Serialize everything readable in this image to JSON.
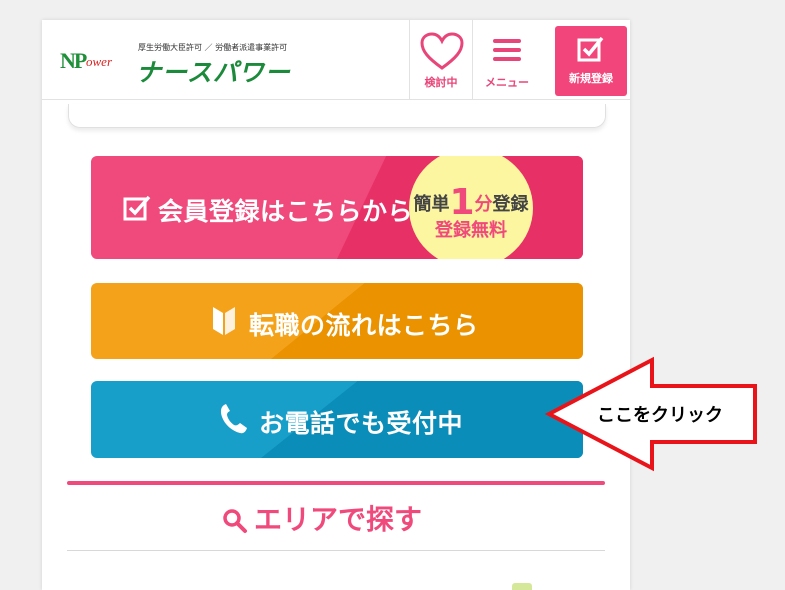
{
  "header": {
    "logo_mark": "NP",
    "logo_mark_suffix": "ower",
    "permit_text": "厚生労働大臣許可 ／ 労働者派遣事業許可",
    "brand_name": "ナースパワー",
    "favorites_label": "検討中",
    "menu_label": "メニュー",
    "register_label": "新規登録"
  },
  "buttons": {
    "register_label": "会員登録はこちらから",
    "badge_prefix": "簡単",
    "badge_number": "1",
    "badge_unit": "分",
    "badge_suffix": "登録",
    "badge_line2": "登録無料",
    "flow_label": "転職の流れはこちら",
    "phone_label": "お電話でも受付中"
  },
  "area_search": {
    "title": "エリアで探す"
  },
  "annotation": {
    "callout_text": "ここをクリック"
  },
  "colors": {
    "pink": "#f0497c",
    "orange": "#f5a21b",
    "blue": "#179fc9",
    "callout_red": "#e8141a"
  }
}
